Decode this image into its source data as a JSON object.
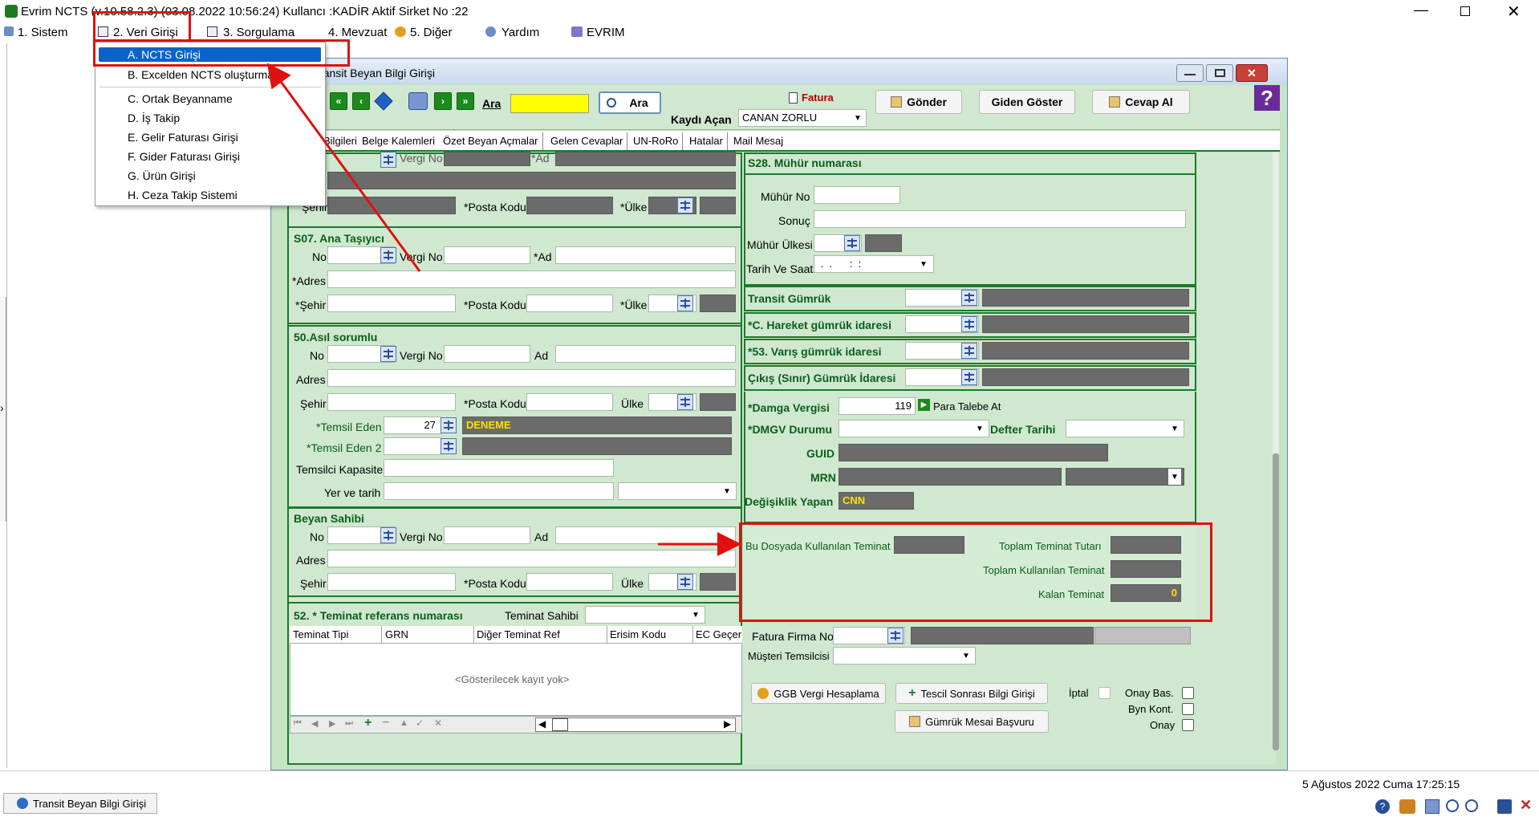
{
  "window": {
    "title": "Evrim NCTS (v.10.58.2.3) (03.08.2022 10:56:24) Kullancı :KADİR Aktif Sirket No :22"
  },
  "menubar": [
    "1. Sistem",
    "2. Veri Girişi",
    "3. Sorgulama",
    "4. Mevzuat",
    "5. Diğer",
    "Yardım",
    "EVRIM"
  ],
  "dropdown": [
    "A. NCTS Girişi",
    "B. Excelden NCTS oluşturma",
    "C. Ortak Beyanname",
    "D. İş Takip",
    "E. Gelir Faturası Girişi",
    "F. Gider Faturası Girişi",
    "G. Ürün Girişi",
    "H. Ceza Takip Sistemi"
  ],
  "child": {
    "title": "Transit Beyan Bilgi Girişi"
  },
  "toolbar": {
    "ara_label": "Ara",
    "ara_button": "Ara",
    "fatura": "Fatura",
    "kaydi_acan": "Kaydı Açan",
    "kaydi_acan_value": "CANAN ZORLU",
    "gonder": "Gönder",
    "giden_goster": "Giden Göster",
    "cevap_al": "Cevap Al"
  },
  "tabs": [
    "Bilgileri",
    "Belge Kalemleri",
    "Özet Beyan Açmalar",
    "Gelen Cevaplar",
    "UN-RoRo",
    "Hatalar",
    "Mail Mesaj"
  ],
  "left": {
    "top_vergi": "Vergi No",
    "top_ad": "*Ad",
    "top_sehir": "Şehir",
    "top_posta": "*Posta Kodu",
    "top_ulke": "*Ülke",
    "s07_title": "S07. Ana Taşıyıcı",
    "no": "No",
    "vergi_no": "Vergi No",
    "ad_req": "*Ad",
    "adres_req": "*Adres",
    "sehir_req": "*Şehir",
    "posta_req": "*Posta Kodu",
    "ulke_req": "*Ülke",
    "s50_title": "50.Asıl sorumlu",
    "ad": "Ad",
    "adres": "Adres",
    "sehir": "Şehir",
    "ulke": "Ülke",
    "temsil_eden": "*Temsil Eden",
    "temsil_eden_no": "27",
    "temsil_eden_name": "DENEME",
    "temsil_eden2": "*Temsil Eden 2",
    "temsilci_kapasite": "Temsilci Kapasite",
    "yer_tarih": "Yer ve tarih",
    "beyan_title": "Beyan Sahibi",
    "teminat_title": "52. * Teminat referans numarası",
    "teminat_sahibi": "Teminat Sahibi",
    "teminat_cols": [
      "Teminat Tipi",
      "GRN",
      "Diğer Teminat Ref",
      "Erisim Kodu",
      "EC Geçer"
    ],
    "empty": "<Gösterilecek kayıt yok>"
  },
  "right": {
    "s28_title": "S28. Mühür numarası",
    "muhur_no": "Mühür No",
    "sonuc": "Sonuç",
    "muhur_ulkesi": "Mühür Ülkesi",
    "tarih_saat": "Tarih Ve Saat",
    "tarih_value": " .  .      :  :",
    "transit_gumruk": "Transit Gümrük",
    "hareket": "*C. Hareket gümrük idaresi",
    "varis": "*53. Varış gümrük idaresi",
    "cikis": "Çıkış (Sınır) Gümrük İdaresi",
    "damga": "*Damga Vergisi",
    "damga_value": "119",
    "para_talebe": "Para Talebe At",
    "dmgv": "*DMGV Durumu",
    "defter": "Defter Tarihi",
    "guid": "GUID",
    "mrn": "MRN",
    "degisiklik": "Değişiklik Yapan",
    "degisiklik_value": "CNN",
    "bu_dosya": "Bu Dosyada Kullanılan Teminat",
    "toplam_teminat": "Toplam Teminat Tutarı",
    "toplam_kullanilan": "Toplam Kullanılan Teminat",
    "kalan": "Kalan Teminat",
    "kalan_value": "0",
    "fatura_firma": "Fatura Firma No",
    "musteri_temsilci": "Müşteri Temsilcisi",
    "ggb": "GGB Vergi Hesaplama",
    "tescil": "Tescil Sonrası Bilgi Girişi",
    "iptal": "İptal",
    "onay_bas": "Onay Bas.",
    "byn_kont": "Byn Kont.",
    "onay": "Onay",
    "gumruk_mesai": "Gümrük Mesai Başvuru"
  },
  "status": {
    "date": "5 Ağustos 2022 Cuma 17:25:15",
    "taskbar": "Transit Beyan Bilgi Girişi"
  },
  "colors": {
    "panel": "#cfe8cf",
    "menu_highlight": "#0a64c8",
    "annotation": "#e01010",
    "group_border": "#1b7a2a"
  }
}
